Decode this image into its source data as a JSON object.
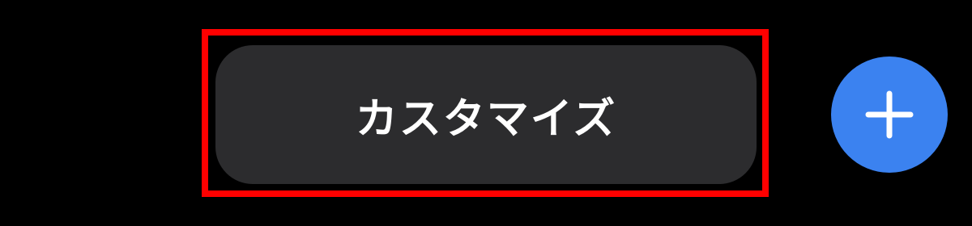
{
  "customize_button": {
    "label": "カスタマイズ"
  },
  "add_button": {
    "icon": "plus-icon"
  },
  "colors": {
    "background": "#000000",
    "button_background": "#2c2c2e",
    "button_text": "#ffffff",
    "accent": "#3b82f0",
    "highlight": "#ff0000"
  }
}
